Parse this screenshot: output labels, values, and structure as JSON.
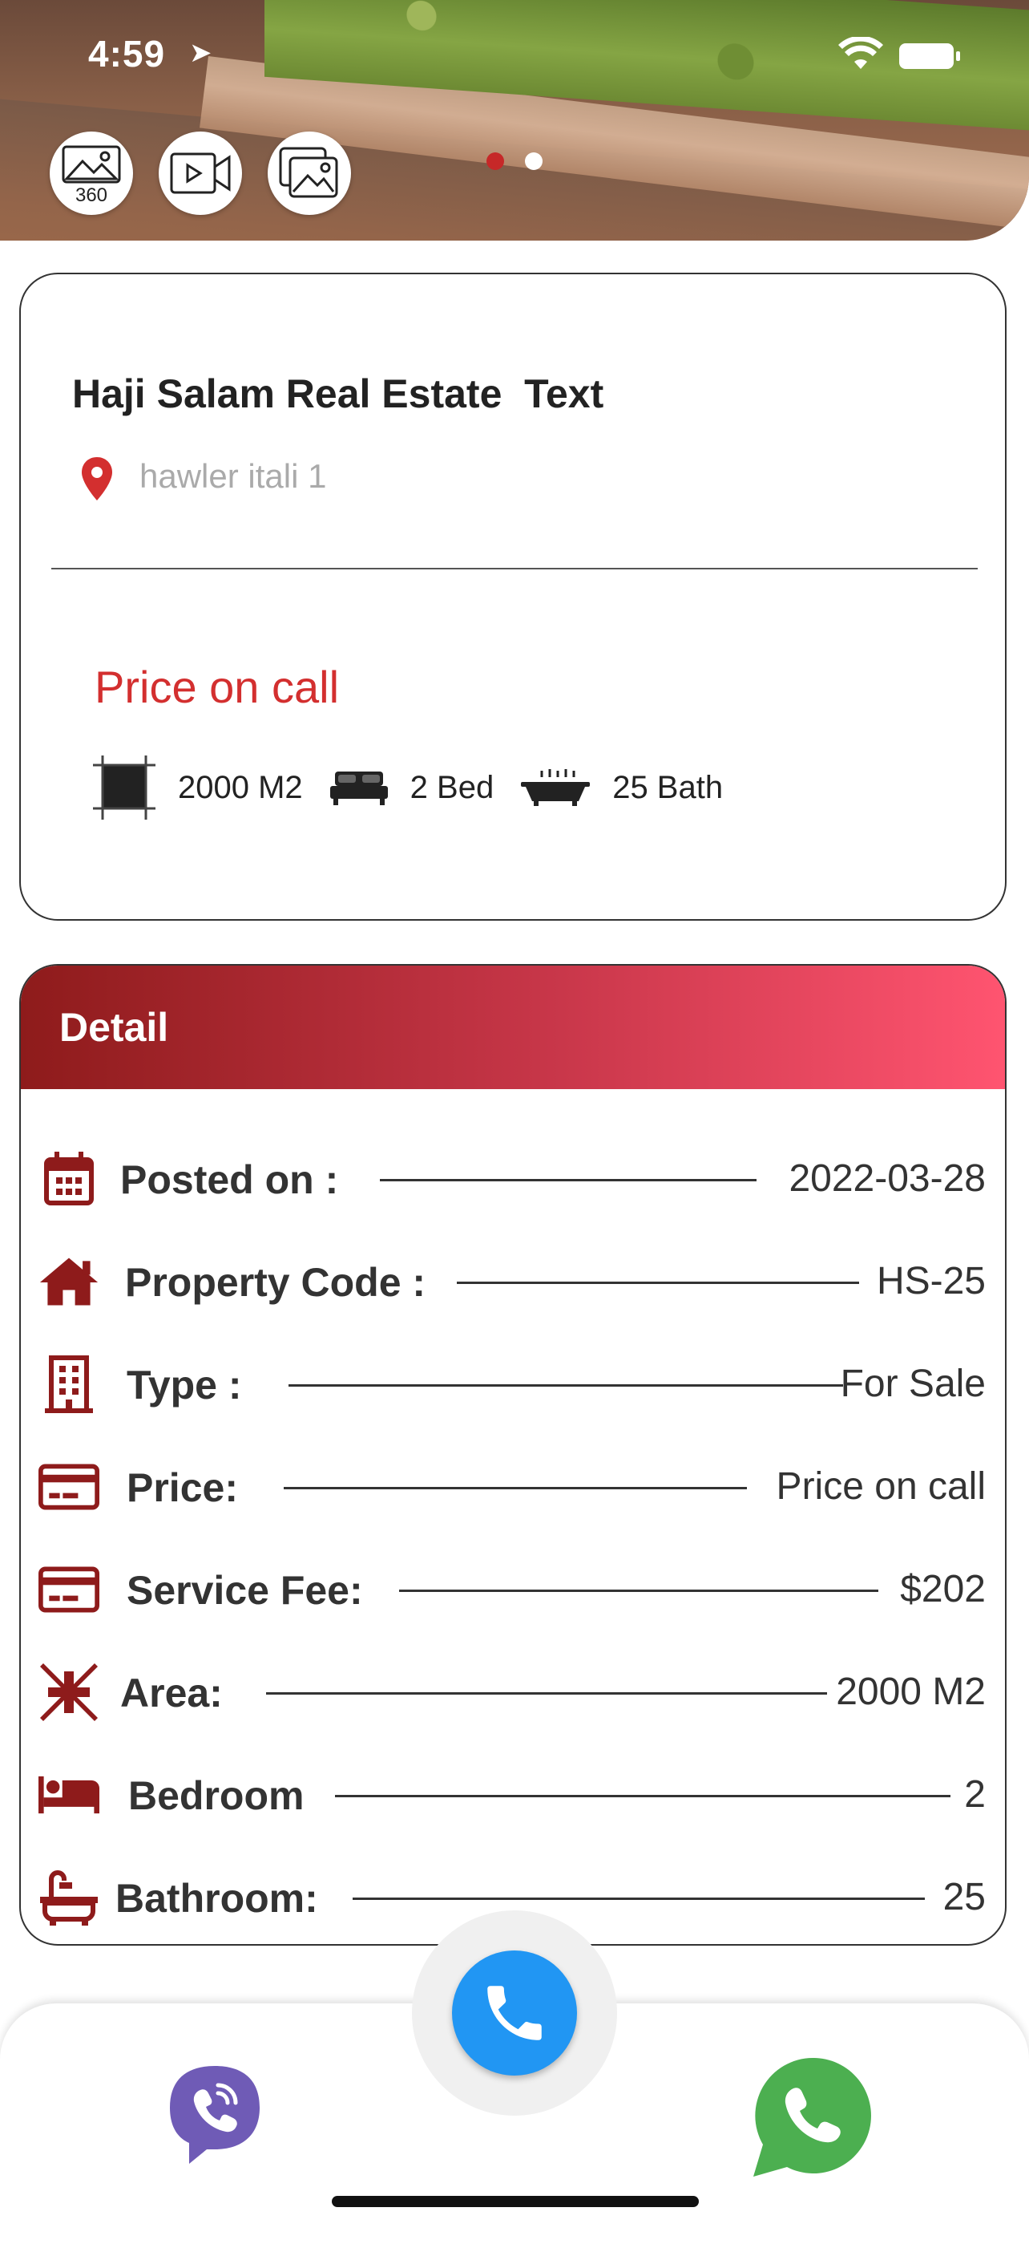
{
  "status_bar": {
    "time": "4:59"
  },
  "hero": {
    "media_buttons": [
      {
        "icon": "panorama-360-icon",
        "label": "360"
      },
      {
        "icon": "video-icon"
      },
      {
        "icon": "gallery-icon"
      }
    ],
    "carousel": {
      "total": 2,
      "active": 1
    }
  },
  "property": {
    "title": "Haji Salam Real Estate  Text",
    "location": "hawler itali 1",
    "price": "Price on call",
    "specs": [
      {
        "icon": "area-icon",
        "text": "2000 M2"
      },
      {
        "icon": "bed-icon",
        "text": "2 Bed"
      },
      {
        "icon": "bathtub-icon",
        "text": "25 Bath"
      }
    ]
  },
  "detail": {
    "header": "Detail",
    "rows": [
      {
        "icon": "calendar-icon",
        "label": "Posted on :",
        "value": "2022-03-28"
      },
      {
        "icon": "home-icon",
        "label": "Property Code :",
        "value": "HS-25"
      },
      {
        "icon": "building-icon",
        "label": "Type :",
        "value": "For Sale"
      },
      {
        "icon": "credit-card-icon",
        "label": "Price:",
        "value": "Price on call"
      },
      {
        "icon": "credit-card-icon",
        "label": "Service Fee:",
        "value": "$202"
      },
      {
        "icon": "compress-icon",
        "label": "Area:",
        "value": "2000 M2"
      },
      {
        "icon": "bed-icon",
        "label": "Bedroom",
        "value": "2"
      },
      {
        "icon": "bathtub-icon",
        "label": "Bathroom:",
        "value": "25"
      }
    ]
  },
  "bottom_bar": {
    "actions": [
      {
        "icon": "viber-icon"
      },
      {
        "icon": "phone-icon"
      },
      {
        "icon": "whatsapp-icon"
      }
    ]
  },
  "colors": {
    "accent_red": "#d32f2f",
    "detail_icon": "#8e1b1b",
    "header_gradient_start": "#8e1b1b",
    "header_gradient_end": "#ff5470",
    "call_blue": "#2196f3",
    "viber_purple": "#6f5bb6",
    "whatsapp_green": "#4caf50"
  }
}
